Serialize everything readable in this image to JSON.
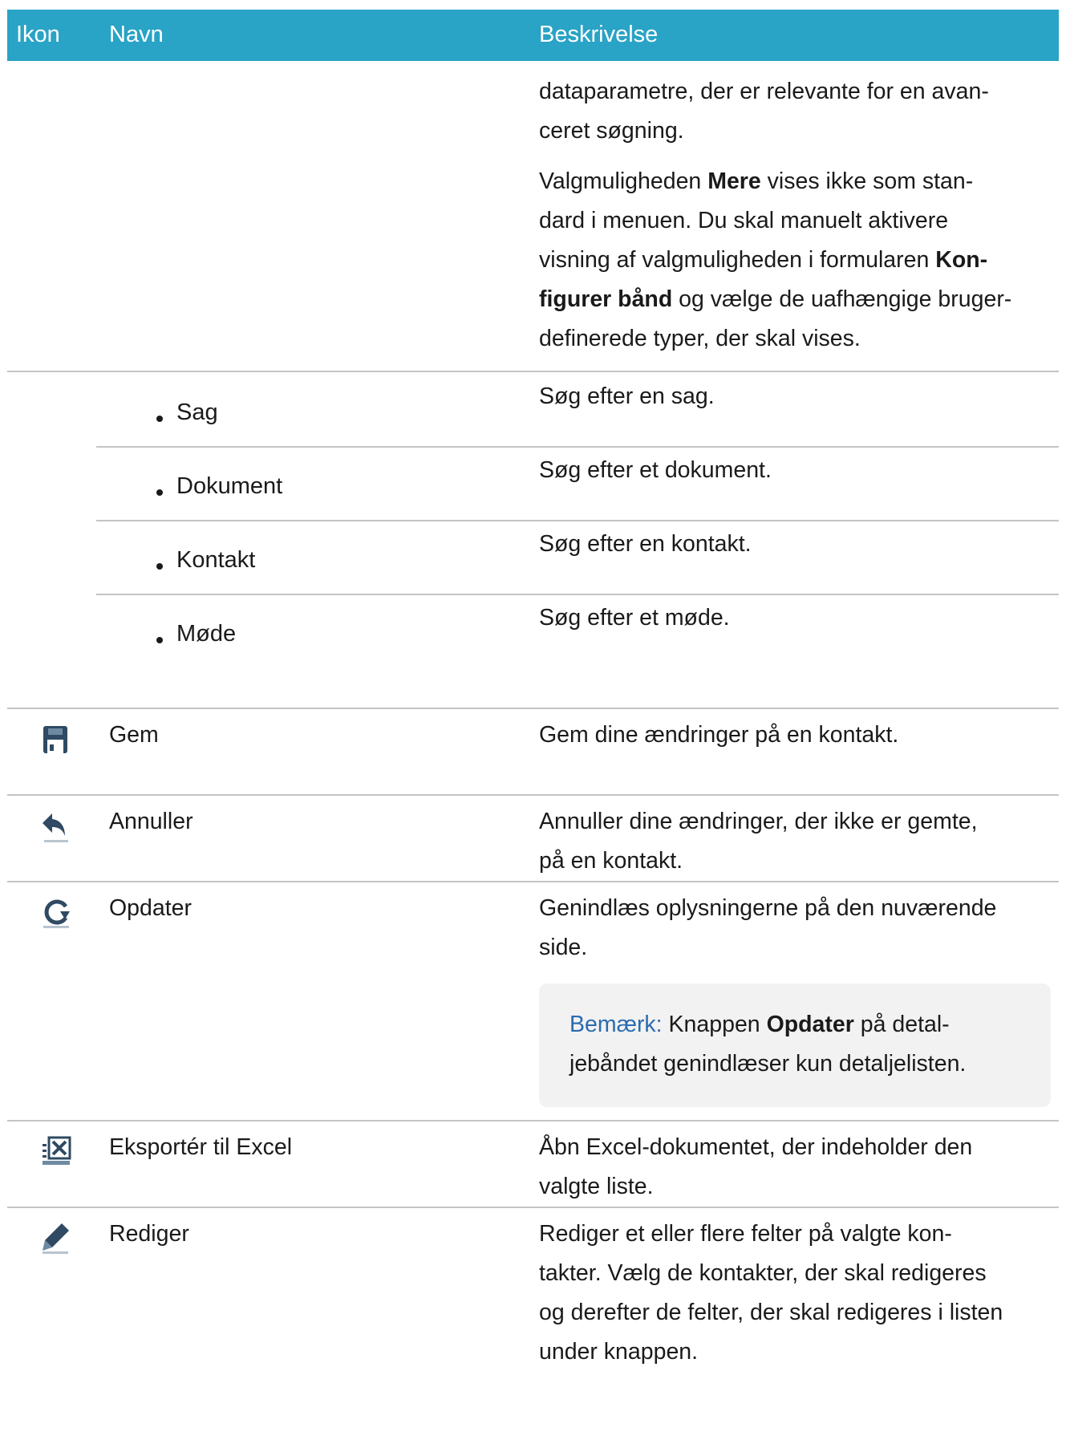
{
  "header": {
    "col_icon": "Ikon",
    "col_name": "Navn",
    "col_desc": "Beskrivelse"
  },
  "intro": {
    "para1_line1": "dataparametre, der er relevante for en avan-",
    "para1_line2": "ceret søgning.",
    "para2_a": "Valgmuligheden ",
    "para2_b": "Mere",
    "para2_c": " vises ikke som stan-",
    "para2_line2": "dard i menuen. Du skal manuelt aktivere",
    "para2_line3a": "visning af valgmuligheden i formularen ",
    "para2_line3b": "Kon-",
    "para2_line4a": "figurer bånd",
    "para2_line4b": " og vælge de uafhængige bruger-",
    "para2_line5": "definerede typer, der skal vises."
  },
  "sub_items": [
    {
      "label": "Sag",
      "desc": "Søg efter en sag."
    },
    {
      "label": "Dokument",
      "desc": "Søg efter et dokument."
    },
    {
      "label": "Kontakt",
      "desc": "Søg efter en kontakt."
    },
    {
      "label": "Møde",
      "desc": "Søg efter et møde."
    }
  ],
  "rows": {
    "gem": {
      "icon": "save-icon",
      "name": "Gem",
      "desc": "Gem dine ændringer på en kontakt."
    },
    "annuller": {
      "icon": "undo-icon",
      "name": "Annuller",
      "desc_l1": "Annuller dine ændringer, der ikke er gemte,",
      "desc_l2": "på en kontakt."
    },
    "opdater": {
      "icon": "refresh-icon",
      "name": "Opdater",
      "desc_l1": "Genindlæs oplysningerne på den nuværende",
      "desc_l2": "side.",
      "note_label": "Bemærk:",
      "note_a": " Knappen ",
      "note_b": "Opdater",
      "note_c": " på detal-",
      "note_l2": "jebåndet genindlæser kun detaljelisten."
    },
    "excel": {
      "icon": "excel-export-icon",
      "name": "Eksportér til Excel",
      "desc_l1": "Åbn Excel-dokumentet, der indeholder den",
      "desc_l2": "valgte liste."
    },
    "rediger": {
      "icon": "pencil-icon",
      "name": "Rediger",
      "desc_l1": "Rediger et eller flere felter på valgte kon-",
      "desc_l2": "takter. Vælg de kontakter, der skal redigeres",
      "desc_l3": "og derefter de felter, der skal redigeres i listen",
      "desc_l4": "under knappen."
    }
  }
}
